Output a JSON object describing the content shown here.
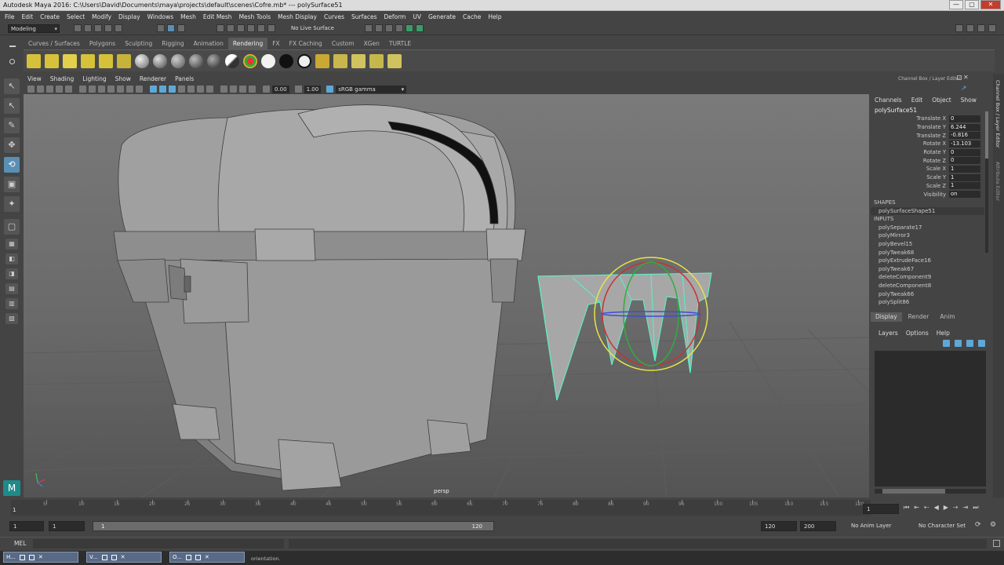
{
  "title": "Autodesk Maya 2016: C:\\Users\\David\\Documents\\maya\\projects\\default\\scenes\\Cofre.mb*   ---   polySurface51",
  "window_buttons": [
    "—",
    "▢",
    "✕"
  ],
  "menu": [
    "File",
    "Edit",
    "Create",
    "Select",
    "Modify",
    "Display",
    "Windows",
    "Mesh",
    "Edit Mesh",
    "Mesh Tools",
    "Mesh Display",
    "Curves",
    "Surfaces",
    "Deform",
    "UV",
    "Generate",
    "Cache",
    "Help"
  ],
  "mode": "Modeling",
  "live_surface": "No Live Surface",
  "shelf_tabs": [
    "Curves / Surfaces",
    "Polygons",
    "Sculpting",
    "Rigging",
    "Animation",
    "Rendering",
    "FX",
    "FX Caching",
    "Custom",
    "XGen",
    "TURTLE"
  ],
  "active_shelf_tab": "Rendering",
  "viewport": {
    "menu": [
      "View",
      "Shading",
      "Lighting",
      "Show",
      "Renderer",
      "Panels"
    ],
    "exposure": "0.00",
    "gamma": "1.00",
    "color_space": "sRGB gamma",
    "camera_label": "persp"
  },
  "channel_box": {
    "header": "Channel Box / Layer Editor",
    "menu": [
      "Channels",
      "Edit",
      "Object",
      "Show"
    ],
    "object": "polySurface51",
    "attributes": [
      {
        "label": "Translate X",
        "value": "0"
      },
      {
        "label": "Translate Y",
        "value": "6.244"
      },
      {
        "label": "Translate Z",
        "value": "-0.816"
      },
      {
        "label": "Rotate X",
        "value": "-13.103"
      },
      {
        "label": "Rotate Y",
        "value": "0"
      },
      {
        "label": "Rotate Z",
        "value": "0"
      },
      {
        "label": "Scale X",
        "value": "1"
      },
      {
        "label": "Scale Y",
        "value": "1"
      },
      {
        "label": "Scale Z",
        "value": "1"
      },
      {
        "label": "Visibility",
        "value": "on"
      }
    ],
    "shapes_label": "SHAPES",
    "shapes": [
      "polySurfaceShape51"
    ],
    "inputs_label": "INPUTS",
    "inputs": [
      "polySeparate17",
      "polyMirror3",
      "polyBevel15",
      "polyTweak68",
      "polyExtrudeFace16",
      "polyTweak67",
      "deleteComponent9",
      "deleteComponent8",
      "polyTweak66",
      "polySplit86"
    ]
  },
  "side_tabs": [
    "Channel Box / Layer Editor",
    "Attribute Editor"
  ],
  "layer_editor": {
    "tabs": [
      "Display",
      "Render",
      "Anim"
    ],
    "active_tab": "Display",
    "menu": [
      "Layers",
      "Options",
      "Help"
    ]
  },
  "timeline": {
    "current_frame": "1",
    "ticks": [
      "5",
      "10",
      "15",
      "20",
      "25",
      "30",
      "35",
      "40",
      "45",
      "50",
      "55",
      "60",
      "65",
      "70",
      "75",
      "80",
      "85",
      "90",
      "95",
      "100",
      "105",
      "110",
      "115",
      "120"
    ],
    "frame_field": "1"
  },
  "range": {
    "start": "1",
    "playback_start": "1",
    "slider_start": "1",
    "slider_end": "120",
    "playback_end": "120",
    "end": "200",
    "anim_layer": "No Anim Layer",
    "character_set": "No Character Set"
  },
  "mel_label": "MEL",
  "help_line": "orientation.",
  "taskbar": [
    "H...",
    "V...",
    "O..."
  ]
}
